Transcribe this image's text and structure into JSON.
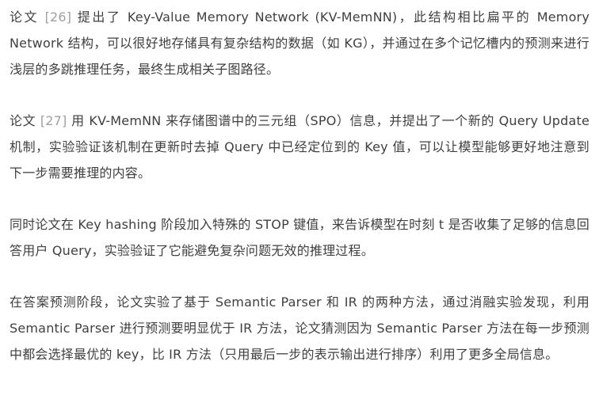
{
  "article": {
    "paragraphs": [
      {
        "before": "论文 ",
        "ref": "[26]",
        "after": " 提出了 Key-Value Memory Network (KV-MemNN)，此结构相比扁平的 Memory Network 结构，可以很好地存储具有复杂结构的数据（如 KG），并通过在多个记忆槽内的预测来进行浅层的多跳推理任务，最终生成相关子图路径。"
      },
      {
        "before": "论文 ",
        "ref": "[27]",
        "after": " 用 KV-MemNN 来存储图谱中的三元组（SPO）信息，并提出了一个新的 Query Update 机制，实验验证该机制在更新时去掉 Query 中已经定位到的 Key 值，可以让模型能够更好地注意到下一步需要推理的内容。"
      },
      {
        "text": "同时论文在 Key hashing 阶段加入特殊的 STOP 键值，来告诉模型在时刻 t 是否收集了足够的信息回答用户 Query，实验验证了它能避免复杂问题无效的推理过程。"
      },
      {
        "text": "在答案预测阶段，论文实验了基于 Semantic Parser 和 IR 的两种方法，通过消融实验发现，利用 Semantic Parser 进行预测要明显优于 IR 方法，论文猜测因为 Semantic Parser 方法在每一步预测中都会选择最优的 key，比 IR 方法（只用最后一步的表示输出进行排序）利用了更多全局信息。"
      }
    ]
  },
  "colors": {
    "text": "#3f3f3f",
    "reference": "#a0a0a0",
    "background": "#ffffff"
  }
}
